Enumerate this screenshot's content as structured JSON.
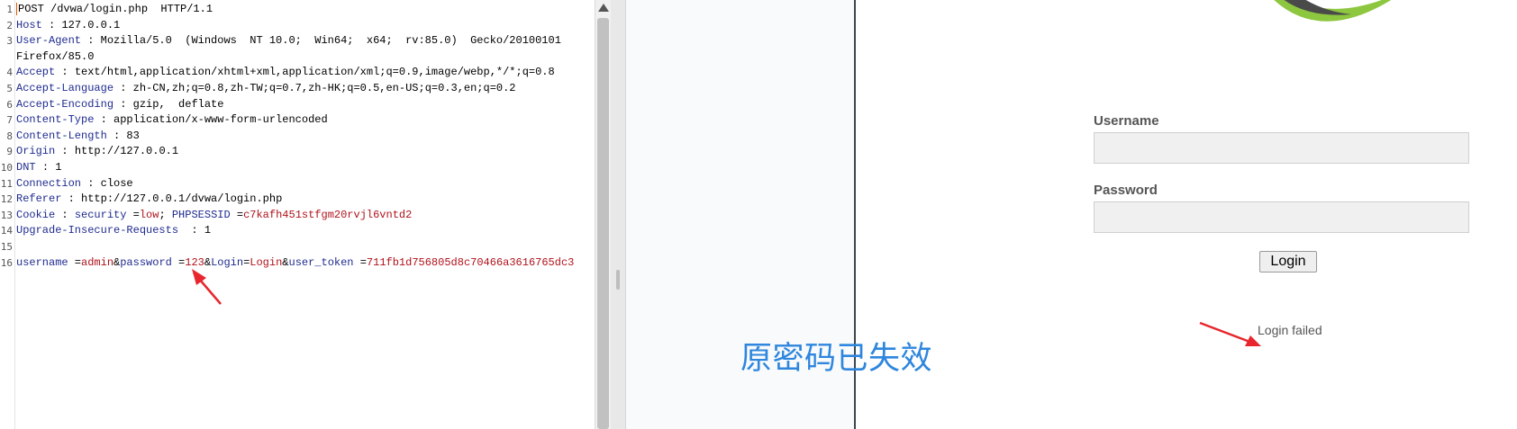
{
  "request_editor": {
    "line_numbers": [
      "1",
      "2",
      "3",
      "",
      "4",
      "5",
      "6",
      "7",
      "8",
      "9",
      "10",
      "11",
      "12",
      "13",
      "14",
      "15",
      "16"
    ],
    "request_line": "POST /dvwa/login.php  HTTP/1.1",
    "headers": [
      {
        "key": "Host",
        "value": ": 127.0.0.1"
      },
      {
        "key": "User-Agent",
        "value": ": Mozilla/5.0  (Windows  NT 10.0;  Win64;  x64;  rv:85.0)  Gecko/20100101"
      },
      {
        "key": "",
        "value": "Firefox/85.0"
      },
      {
        "key": "Accept",
        "value": ": text/html,application/xhtml+xml,application/xml;q=0.9,image/webp,*/*;q=0.8"
      },
      {
        "key": "Accept-Language",
        "value": ": zh-CN,zh;q=0.8,zh-TW;q=0.7,zh-HK;q=0.5,en-US;q=0.3,en;q=0.2"
      },
      {
        "key": "Accept-Encoding",
        "value": ": gzip,  deflate"
      },
      {
        "key": "Content-Type",
        "value": ": application/x-www-form-urlencoded"
      },
      {
        "key": "Content-Length",
        "value": ": 83"
      },
      {
        "key": "Origin",
        "value": ": http://127.0.0.1"
      },
      {
        "key": "DNT",
        "value": ": 1"
      },
      {
        "key": "Connection",
        "value": ": close"
      },
      {
        "key": "Referer",
        "value": ": http://127.0.0.1/dvwa/login.php"
      }
    ],
    "cookie": {
      "key": "Cookie",
      "sep": " : ",
      "k1": "security",
      "eq1": " =",
      "v1": "low",
      "semi": "; ",
      "k2": "PHPSESSID",
      "eq2": " =",
      "v2": "c7kafh451stfgm20rvjl6vntd2"
    },
    "upgrade_header": {
      "key": "Upgrade-Insecure-Requests",
      "value": "  : 1"
    },
    "body": {
      "k1": "username",
      "eq1": " =",
      "v1": "admin",
      "amp1": "&",
      "k2": "password",
      "eq2": " =",
      "v2": "123",
      "amp2": "&",
      "k3": "Login",
      "eq3": "=",
      "v3": "Login",
      "amp3": "&",
      "k4": "user_token",
      "eq4": " =",
      "v4": "711fb1d756805d8c70466a3616765dc3"
    }
  },
  "login_form": {
    "username_label": "Username",
    "password_label": "Password",
    "username_value": "",
    "password_value": "",
    "button_label": "Login",
    "message": "Login failed"
  },
  "annotation": {
    "overlay_text": "原密码已失效"
  },
  "colors": {
    "annotation_arrow": "#e8262e",
    "annotation_text": "#2e86de",
    "logo_green": "#8dc63f",
    "logo_dark": "#4a4a4a"
  }
}
